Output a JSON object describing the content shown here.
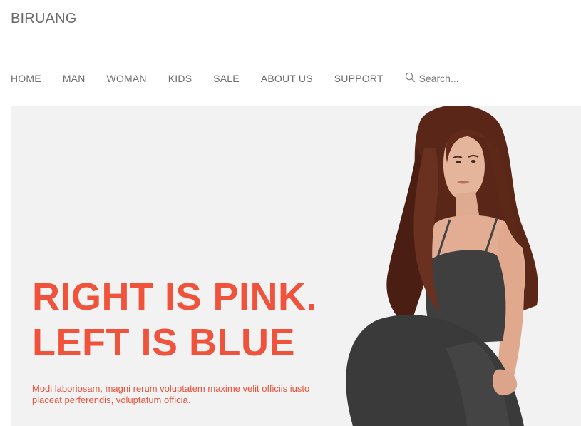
{
  "brand": {
    "name": "BIRUANG"
  },
  "nav": {
    "items": [
      {
        "label": "HOME"
      },
      {
        "label": "MAN"
      },
      {
        "label": "WOMAN"
      },
      {
        "label": "KIDS"
      },
      {
        "label": "SALE"
      },
      {
        "label": "ABOUT US"
      },
      {
        "label": "SUPPORT"
      }
    ],
    "search": {
      "placeholder": "Search...",
      "icon": "search-icon"
    }
  },
  "hero": {
    "title_line1": "RIGHT IS PINK.",
    "title_line2": "LEFT IS BLUE",
    "subtitle": "Modi laboriosam, magni rerum voluptatem maxime velit officiis iusto placeat perferendis, voluptatum officia.",
    "image": "model-photo",
    "accent_color": "#f0533c",
    "background_color": "#f3f2f2"
  }
}
